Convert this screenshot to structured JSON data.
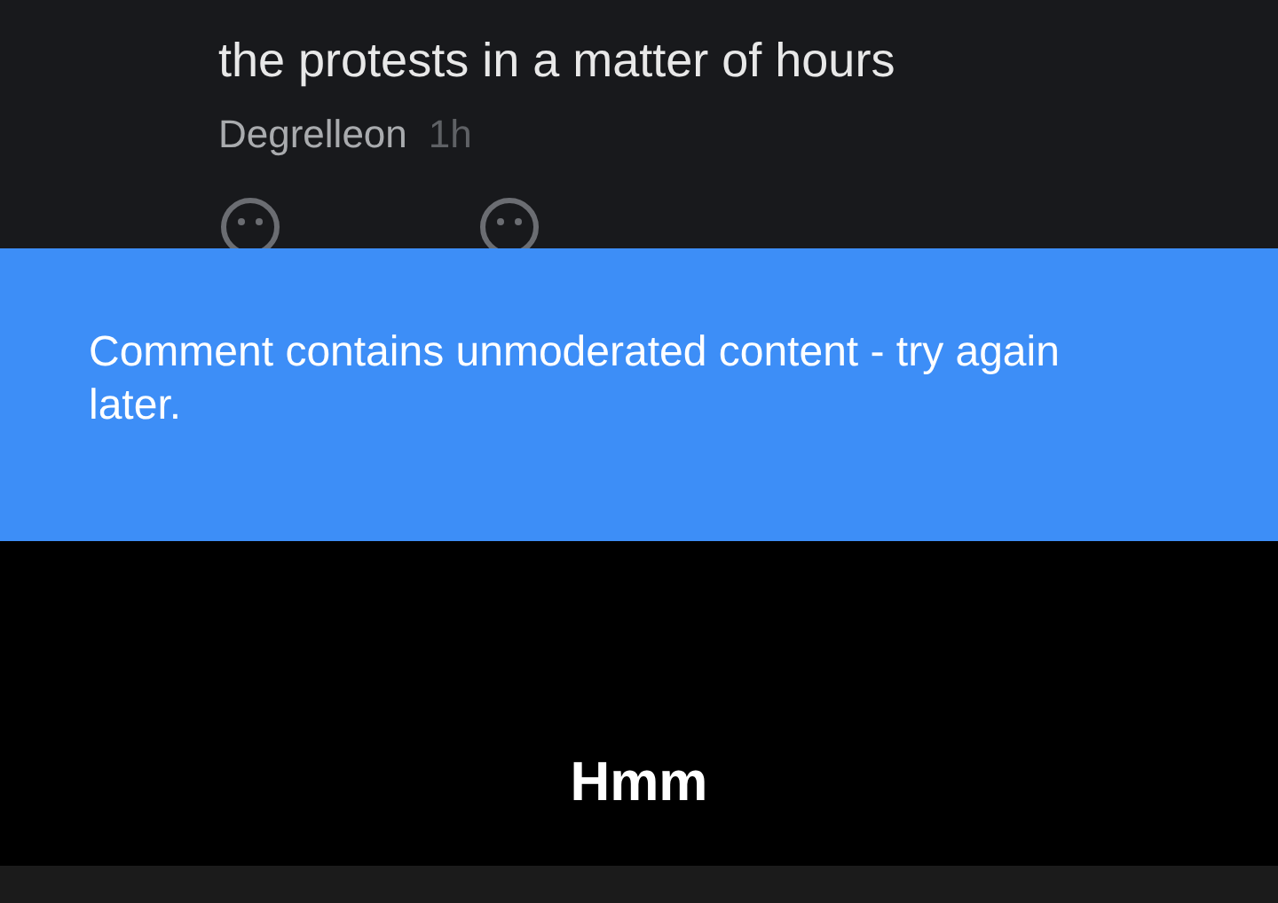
{
  "comment": {
    "lines": [
      "the protests in a matter of hours"
    ],
    "author": "Degrelleon",
    "time": "1h"
  },
  "snackbar": {
    "message": "Comment contains unmoderated content - try again later."
  },
  "caption": "Hmm"
}
